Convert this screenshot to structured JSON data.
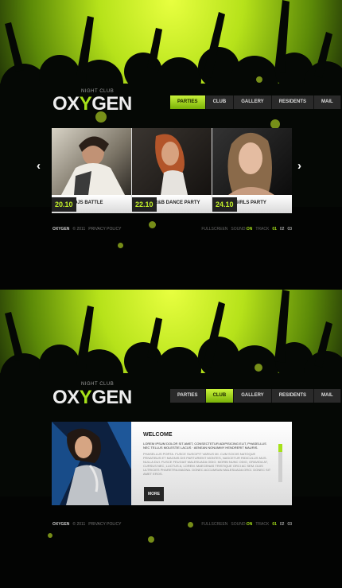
{
  "logo": {
    "text_a": "OX",
    "text_y": "Y",
    "text_b": "GEN",
    "subtitle": "NIGHT CLUB"
  },
  "screen1": {
    "nav": [
      "PARTIES",
      "CLUB",
      "GALLERY",
      "RESIDENTS",
      "MAIL"
    ],
    "active_nav": "PARTIES",
    "events": [
      {
        "date": "20.10",
        "title": "DJS BATTLE"
      },
      {
        "date": "22.10",
        "title": "R&B DANCE PARTY"
      },
      {
        "date": "24.10",
        "title": "GIRLS PARTY"
      }
    ],
    "arrow_left": "‹",
    "arrow_right": "›"
  },
  "screen2": {
    "nav": [
      "PARTIES",
      "CLUB",
      "GALLERY",
      "RESIDENTS",
      "MAIL"
    ],
    "active_nav": "CLUB",
    "welcome": {
      "heading": "WELCOME",
      "para1": "LOREM IPSUM DOLOR SIT AMET, CONSECTETUR ADIPISICING ELIT, PHASELLUS NEC TELLUS MOLESTIE LACUS · AENEAN NONUMMY HENDRERIT MAURIS.",
      "para2": "PHASELLUS PORTA. FUSCE SUSCIPIT VARIUS MI. CUM SOCIIS NATOQUE PENATIBUS ET MAGNIS DIS PARTURIENT MONTES, NASCETUR RIDICULUS MUS. NULLA DUI. FUSCE FEUGIAT MALESUADA ODIO. MORBI NUNC ODIO, GRAVIDA AT, CURSUS NEC, LUCTUS A, LOREM. MAECENAS TRISTIQUE ORCI AC SEM. DUIS ULTRICIES PHARETRA MAGNA. DONEC ACCUMSAN MALESUADA ORCI. DONEC SIT AMET EROS.",
      "more": "MORE"
    }
  },
  "footer": {
    "brand": "OXYGEN",
    "copyright": "© 2011",
    "privacy": "PRIVACY POLICY",
    "fullscreen": "FULLSCREEN",
    "sound_label": "SOUND:",
    "sound_value": "ON",
    "track_label": "TRACK",
    "tracks": [
      "01",
      "02",
      "03"
    ]
  },
  "colors": {
    "accent": "#a6e11a",
    "nav_bg": "#2a2a2a"
  }
}
